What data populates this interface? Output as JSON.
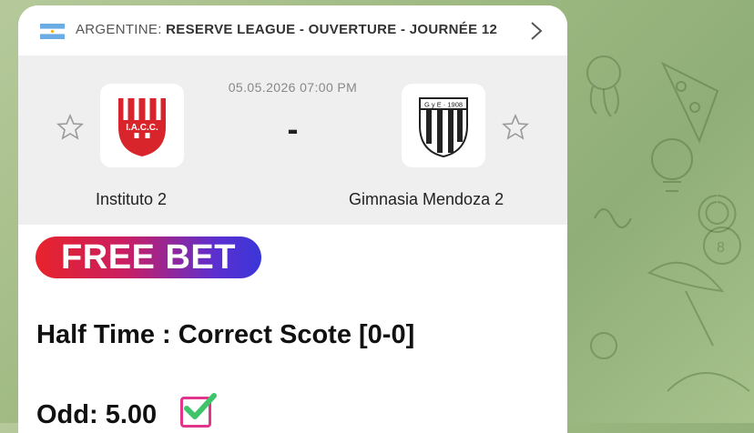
{
  "league": {
    "country": "ARGENTINE:",
    "name": "RESERVE LEAGUE - OUVERTURE - JOURNÉE 12"
  },
  "match": {
    "datetime": "05.05.2026 07:00 PM",
    "separator": "-",
    "home_team": "Instituto 2",
    "home_logo_text": "I.A.C.C.",
    "away_team": "Gimnasia Mendoza 2",
    "away_logo_text": "G y E · 1908"
  },
  "post": {
    "badge": "FREE BET",
    "prediction": "Half Time : Correct Scote [0-0]",
    "odd": "Odd: 5.00"
  },
  "colors": {
    "badge_start": "#e8232b",
    "badge_end": "#3a36d8",
    "home_red": "#d8252b",
    "check": "#e0358a",
    "check_mark": "#3fc46a"
  }
}
